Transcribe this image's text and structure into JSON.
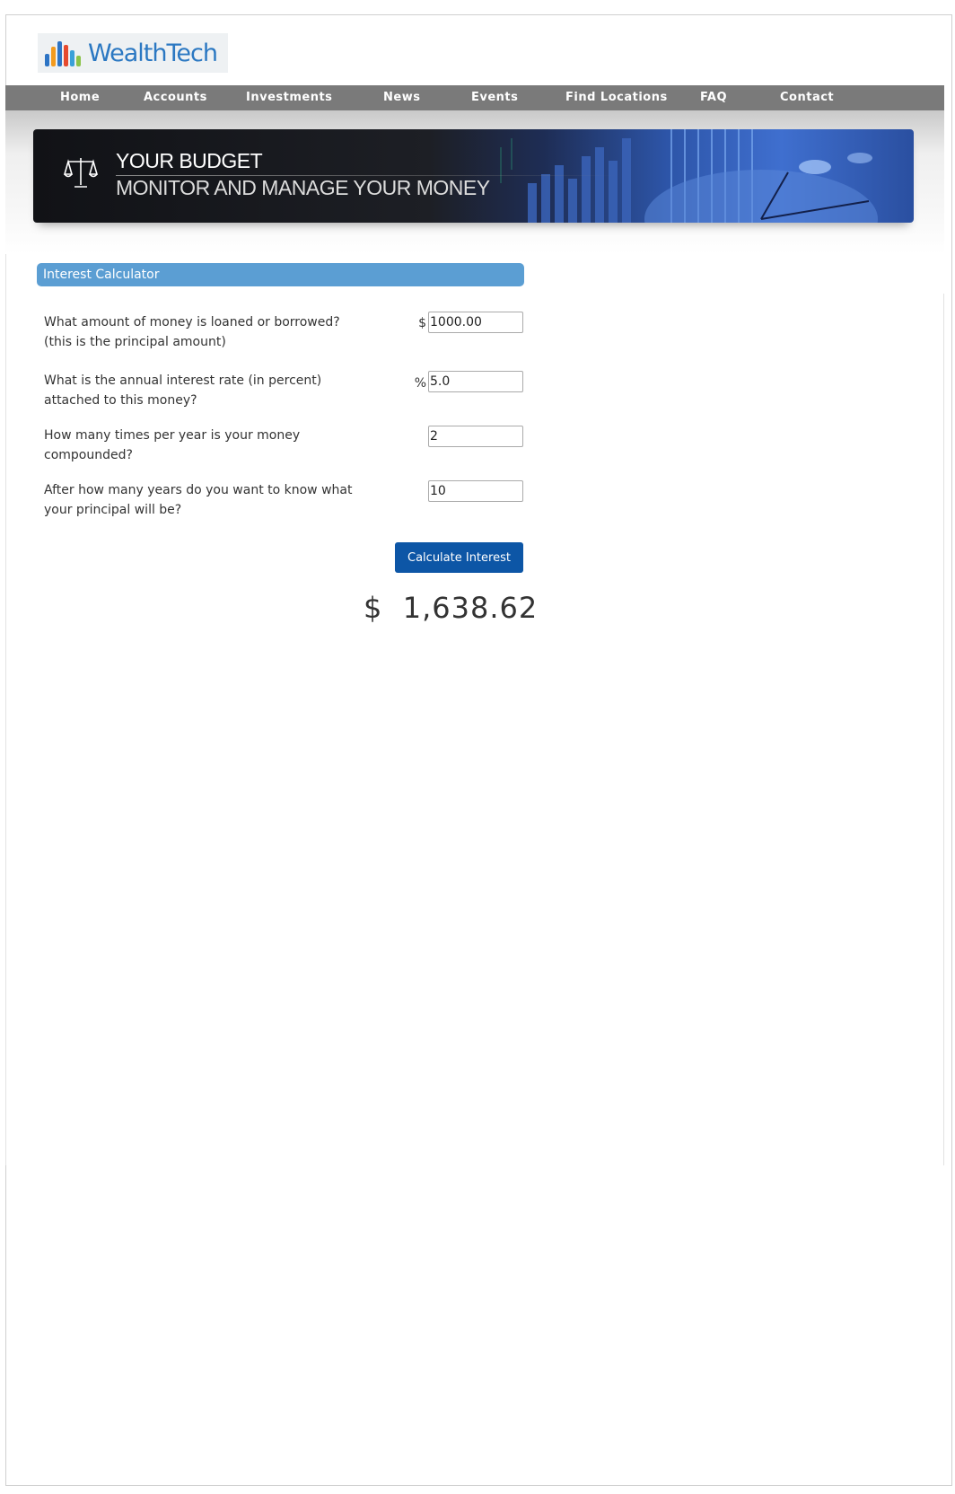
{
  "brand": {
    "name": "WealthTech",
    "logo_bar_colors": [
      "#2d74c4",
      "#f29b1f",
      "#2d74c4",
      "#e64a2e",
      "#3aa0d8",
      "#8bc34a"
    ]
  },
  "nav": {
    "items": [
      {
        "label": "Home"
      },
      {
        "label": "Accounts"
      },
      {
        "label": "Investments"
      },
      {
        "label": "News"
      },
      {
        "label": "Events"
      },
      {
        "label": "Find Locations"
      },
      {
        "label": "FAQ"
      },
      {
        "label": "Contact"
      }
    ]
  },
  "banner": {
    "title": "YOUR BUDGET",
    "subtitle": "MONITOR AND MANAGE YOUR MONEY"
  },
  "calculator": {
    "header": "Interest Calculator",
    "questions": [
      {
        "label": "What amount of money is loaned or borrowed? (this is the principal amount)",
        "unit": "$",
        "value": "1000.00"
      },
      {
        "label": "What is the annual interest rate (in percent) attached to this money?",
        "unit": "%",
        "value": "5.0"
      },
      {
        "label": "How many times per year is your money compounded?",
        "unit": "",
        "value": "2"
      },
      {
        "label": "After how many years do you want to know what your principal will be?",
        "unit": "",
        "value": "10"
      }
    ],
    "button_label": "Calculate Interest",
    "result": "$  1,638.62"
  },
  "colors": {
    "nav_bg": "#7a7a7a",
    "panel_header_bg": "#5b9ed3",
    "button_bg": "#0d56a6",
    "brand_blue": "#2b78c2"
  }
}
